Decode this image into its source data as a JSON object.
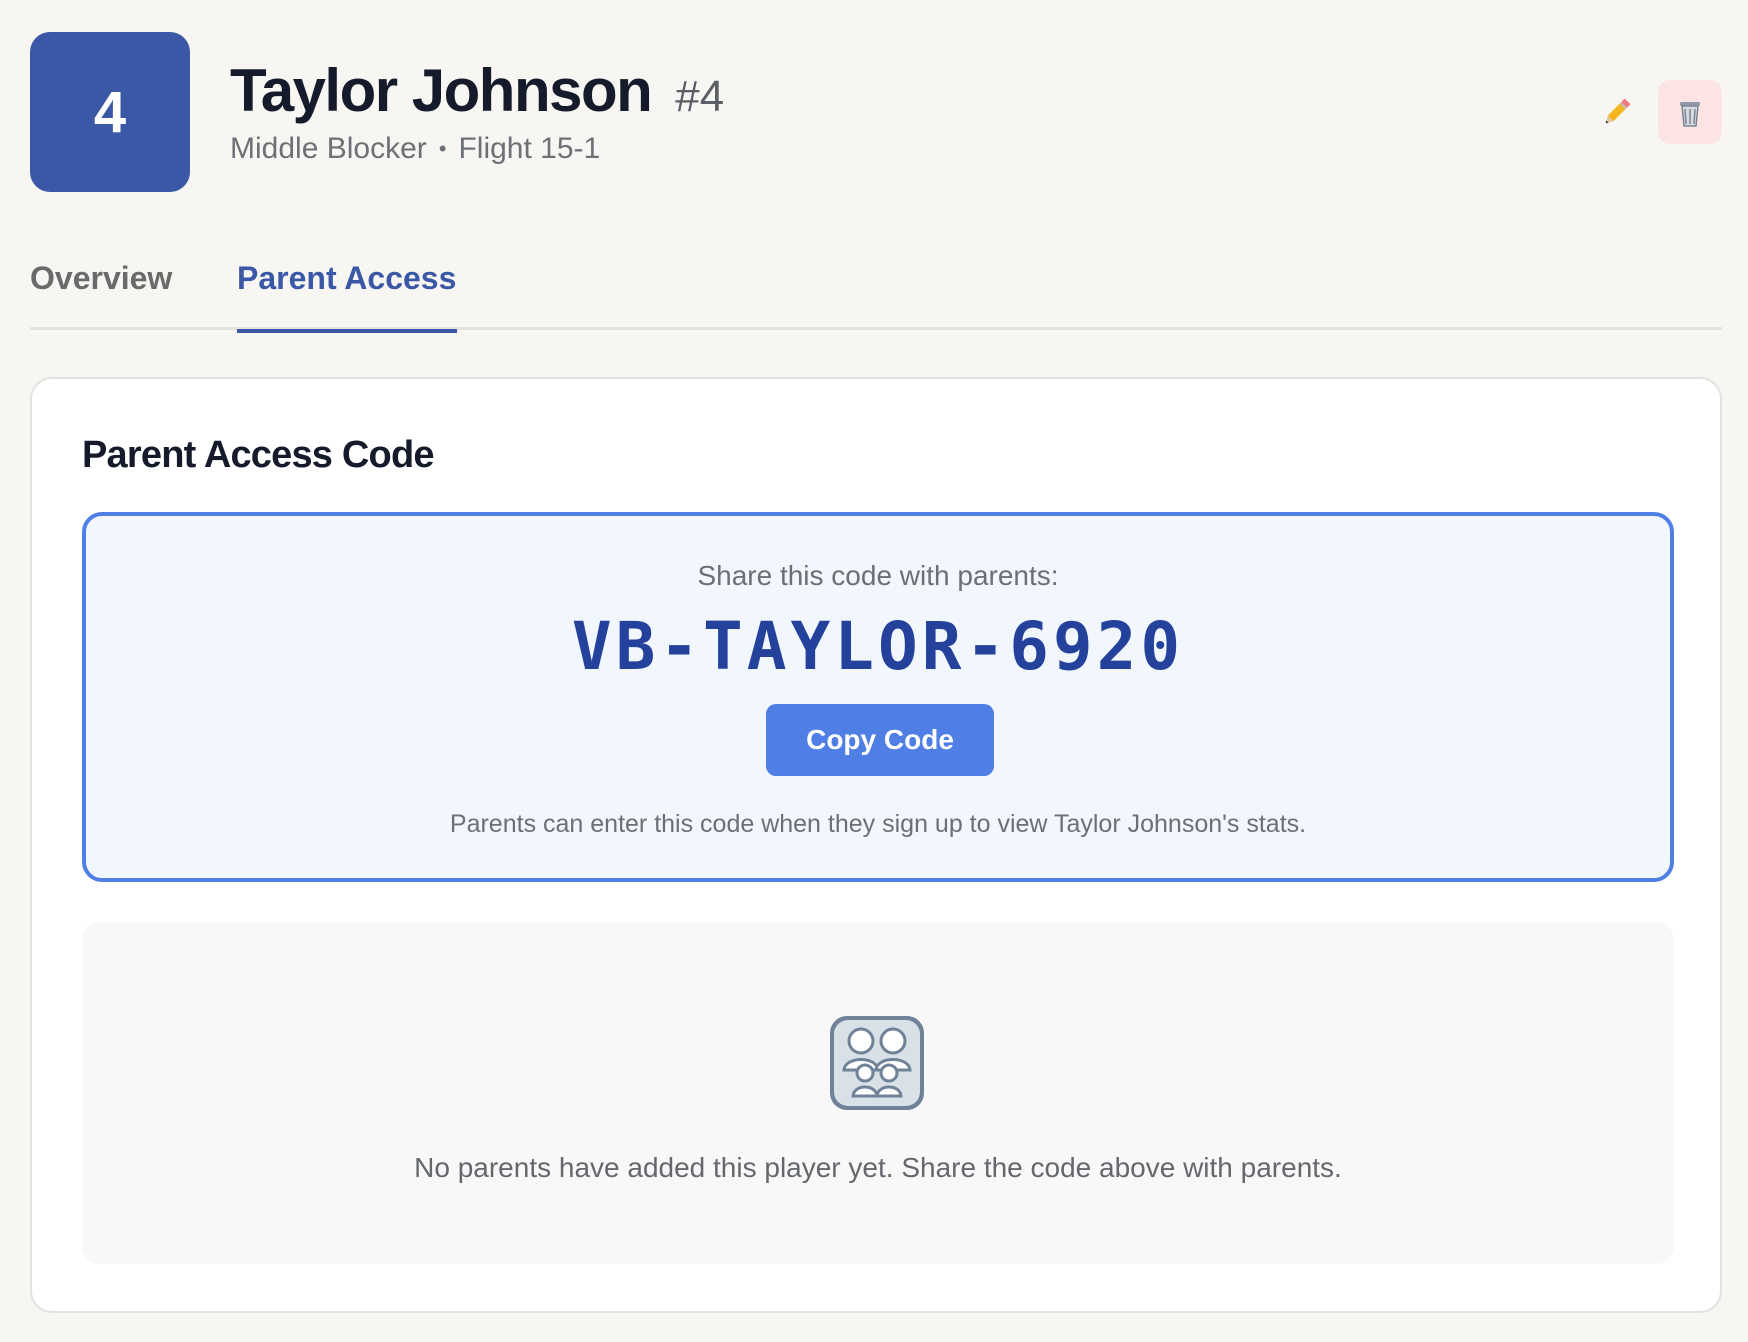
{
  "player": {
    "avatar_number": "4",
    "name": "Taylor Johnson",
    "number": "#4",
    "position": "Middle Blocker",
    "separator": "•",
    "team": "Flight 15-1"
  },
  "tabs": [
    {
      "label": "Overview",
      "active": false
    },
    {
      "label": "Parent Access",
      "active": true
    }
  ],
  "parent_access": {
    "title": "Parent Access Code",
    "share_label": "Share this code with parents:",
    "code": "VB-TAYLOR-6920",
    "copy_label": "Copy Code",
    "help_text": "Parents can enter this code when they sign up to view Taylor Johnson's stats.",
    "empty_message": "No parents have added this player yet. Share the code above with parents."
  },
  "icons": {
    "edit": "pencil-icon",
    "delete": "trash-icon",
    "family": "family-icon"
  },
  "colors": {
    "accent": "#3a58a6",
    "button": "#4f7fe4",
    "code": "#24419c",
    "delete_background": "#fde4e4"
  }
}
